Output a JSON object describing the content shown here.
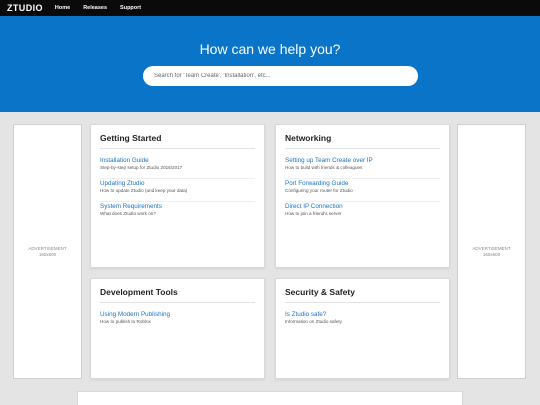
{
  "header": {
    "logo": "ZTUDIO",
    "nav": [
      {
        "label": "Home"
      },
      {
        "label": "Releases"
      },
      {
        "label": "Support"
      }
    ]
  },
  "hero": {
    "title": "How can we help you?",
    "search_placeholder": "Search for 'Team Create', 'Installation', etc..."
  },
  "ads": {
    "left": {
      "label": "ADVERTISEMENT",
      "size": "160x600"
    },
    "right": {
      "label": "ADVERTISEMENT",
      "size": "160x600"
    }
  },
  "sections": [
    {
      "title": "Getting Started",
      "items": [
        {
          "link": "Installation Guide",
          "desc": "Step-by-step setup for Ztudio 2016/2017"
        },
        {
          "link": "Updating Ztudio",
          "desc": "How to update Ztudio (and keep your data)"
        },
        {
          "link": "System Requirements",
          "desc": "What does Ztudio work on?"
        }
      ]
    },
    {
      "title": "Networking",
      "items": [
        {
          "link": "Setting up Team Create over IP",
          "desc": "How to build with friends & colleagues"
        },
        {
          "link": "Port Forwarding Guide",
          "desc": "Configuring your router for Ztudio"
        },
        {
          "link": "Direct IP Connection",
          "desc": "How to join a friend's server"
        }
      ]
    },
    {
      "title": "Development Tools",
      "items": [
        {
          "link": "Using Modern Publishing",
          "desc": "How to publish to Roblox"
        }
      ]
    },
    {
      "title": "Security & Safety",
      "items": [
        {
          "link": "Is Ztudio safe?",
          "desc": "Information on Ztudio safety"
        }
      ]
    }
  ],
  "colors": {
    "topbar": "#0a0a0a",
    "hero": "#0a74c9",
    "link": "#1a73c4",
    "page_bg": "#e4e4e4"
  }
}
